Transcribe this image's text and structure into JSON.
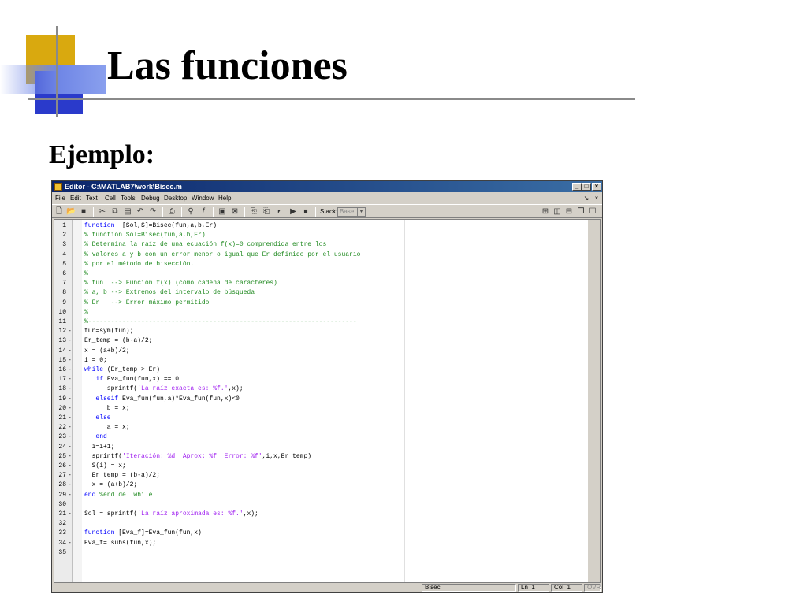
{
  "slide": {
    "title": "Las funciones",
    "subtitle": "Ejemplo:"
  },
  "window": {
    "title": "Editor - C:\\MATLAB7\\work\\Bisec.m",
    "controls": {
      "minimize": "_",
      "maximize": "□",
      "close": "×"
    },
    "menu": [
      "File",
      "Edit",
      "Text",
      "Cell",
      "Tools",
      "Debug",
      "Desktop",
      "Window",
      "Help"
    ],
    "menu_controls": [
      "↘",
      "×"
    ],
    "toolbar": {
      "stack_label": "Stack:",
      "stack_value": "Base"
    }
  },
  "code_lines": [
    {
      "n": "1",
      "bp": "",
      "parts": [
        [
          "kw",
          "function"
        ],
        [
          "",
          "  [Sol,S]=Bisec(fun,a,b,Er)"
        ]
      ]
    },
    {
      "n": "2",
      "bp": "",
      "parts": [
        [
          "cm",
          "% function Sol=Bisec(fun,a,b,Er)"
        ]
      ]
    },
    {
      "n": "3",
      "bp": "",
      "parts": [
        [
          "cm",
          "% Determina la raíz de una ecuación f(x)=0 comprendida entre los"
        ]
      ]
    },
    {
      "n": "4",
      "bp": "",
      "parts": [
        [
          "cm",
          "% valores a y b con un error menor o igual que Er definido por el usuario"
        ]
      ]
    },
    {
      "n": "5",
      "bp": "",
      "parts": [
        [
          "cm",
          "% por el método de bisección."
        ]
      ]
    },
    {
      "n": "6",
      "bp": "",
      "parts": [
        [
          "cm",
          "%"
        ]
      ]
    },
    {
      "n": "7",
      "bp": "",
      "parts": [
        [
          "cm",
          "% fun  --> Función f(x) (como cadena de caracteres)"
        ]
      ]
    },
    {
      "n": "8",
      "bp": "",
      "parts": [
        [
          "cm",
          "% a, b --> Extremos del intervalo de búsqueda"
        ]
      ]
    },
    {
      "n": "9",
      "bp": "",
      "parts": [
        [
          "cm",
          "% Er   --> Error máximo permitido"
        ]
      ]
    },
    {
      "n": "10",
      "bp": "",
      "parts": [
        [
          "cm",
          "%"
        ]
      ]
    },
    {
      "n": "11",
      "bp": "",
      "parts": [
        [
          "cm",
          "%-----------------------------------------------------------------------"
        ]
      ]
    },
    {
      "n": "12",
      "bp": "-",
      "parts": [
        [
          "",
          "fun=sym(fun);"
        ]
      ]
    },
    {
      "n": "13",
      "bp": "-",
      "parts": [
        [
          "",
          "Er_temp = (b-a)/2;"
        ]
      ]
    },
    {
      "n": "14",
      "bp": "-",
      "parts": [
        [
          "",
          "x = (a+b)/2;"
        ]
      ]
    },
    {
      "n": "15",
      "bp": "-",
      "parts": [
        [
          "",
          "i = 0;"
        ]
      ]
    },
    {
      "n": "16",
      "bp": "-",
      "parts": [
        [
          "kw",
          "while"
        ],
        [
          "",
          " (Er_temp > Er)"
        ]
      ]
    },
    {
      "n": "17",
      "bp": "-",
      "parts": [
        [
          "",
          "   "
        ],
        [
          "kw",
          "if"
        ],
        [
          "",
          " Eva_fun(fun,x) == 0"
        ]
      ]
    },
    {
      "n": "18",
      "bp": "-",
      "parts": [
        [
          "",
          "      sprintf("
        ],
        [
          "st",
          "'La raíz exacta es: %f.'"
        ],
        [
          "",
          ",x);"
        ]
      ]
    },
    {
      "n": "19",
      "bp": "-",
      "parts": [
        [
          "",
          "   "
        ],
        [
          "kw",
          "elseif"
        ],
        [
          "",
          " Eva_fun(fun,a)*Eva_fun(fun,x)<0"
        ]
      ]
    },
    {
      "n": "20",
      "bp": "-",
      "parts": [
        [
          "",
          "      b = x;"
        ]
      ]
    },
    {
      "n": "21",
      "bp": "-",
      "parts": [
        [
          "",
          "   "
        ],
        [
          "kw",
          "else"
        ]
      ]
    },
    {
      "n": "22",
      "bp": "-",
      "parts": [
        [
          "",
          "      a = x;"
        ]
      ]
    },
    {
      "n": "23",
      "bp": "-",
      "parts": [
        [
          "",
          "   "
        ],
        [
          "kw",
          "end"
        ]
      ]
    },
    {
      "n": "24",
      "bp": "-",
      "parts": [
        [
          "",
          "  i=i+1;"
        ]
      ]
    },
    {
      "n": "25",
      "bp": "-",
      "parts": [
        [
          "",
          "  sprintf("
        ],
        [
          "st",
          "'Iteración: %d  Aprox: %f  Error: %f'"
        ],
        [
          "",
          ",i,x,Er_temp)"
        ]
      ]
    },
    {
      "n": "26",
      "bp": "-",
      "parts": [
        [
          "",
          "  S(i) = x;"
        ]
      ]
    },
    {
      "n": "27",
      "bp": "-",
      "parts": [
        [
          "",
          "  Er_temp = (b-a)/2;"
        ]
      ]
    },
    {
      "n": "28",
      "bp": "-",
      "parts": [
        [
          "",
          "  x = (a+b)/2;"
        ]
      ]
    },
    {
      "n": "29",
      "bp": "-",
      "parts": [
        [
          "kw",
          "end"
        ],
        [
          "",
          " "
        ],
        [
          "cm",
          "%end del while"
        ]
      ]
    },
    {
      "n": "30",
      "bp": "",
      "parts": [
        [
          "",
          ""
        ]
      ]
    },
    {
      "n": "31",
      "bp": "-",
      "parts": [
        [
          "",
          "Sol = sprintf("
        ],
        [
          "st",
          "'La raíz aproximada es: %f.'"
        ],
        [
          "",
          ",x);"
        ]
      ]
    },
    {
      "n": "32",
      "bp": "",
      "parts": [
        [
          "",
          ""
        ]
      ]
    },
    {
      "n": "33",
      "bp": "",
      "parts": [
        [
          "kw",
          "function"
        ],
        [
          "",
          " [Eva_f]=Eva_fun(fun,x)"
        ]
      ]
    },
    {
      "n": "34",
      "bp": "-",
      "parts": [
        [
          "",
          "Eva_f= subs(fun,x);"
        ]
      ]
    },
    {
      "n": "35",
      "bp": "",
      "parts": [
        [
          "",
          ""
        ]
      ]
    }
  ],
  "status": {
    "file": "Bisec",
    "ln_label": "Ln",
    "ln_value": "1",
    "col_label": "Col",
    "col_value": "1",
    "ovr": "OVR"
  },
  "colors": {
    "keyword": "#0000ff",
    "comment": "#228b22",
    "string": "#a020f0",
    "titlebar": "#0a246a",
    "deco_yellow": "#d9a90f",
    "deco_blue": "#2a3acb"
  }
}
